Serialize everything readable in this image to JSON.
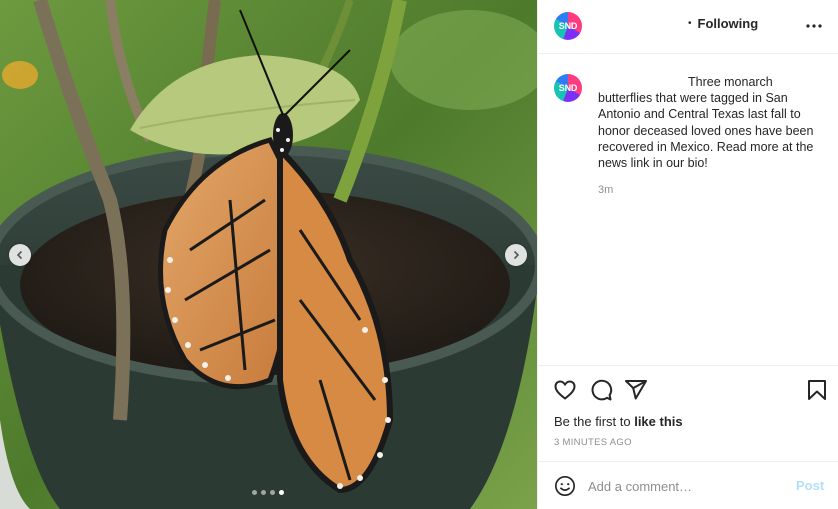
{
  "post": {
    "account_initials": "SND",
    "follow_status": "Following",
    "follow_separator": "•",
    "caption": "Three monarch butterflies that were tagged in San Antonio and Central Texas last fall to honor deceased loved ones have been recovered in Mexico. Read more at the news link in our bio!",
    "caption_age": "3m",
    "likes_prefix": "Be the first to ",
    "likes_cta": "like this",
    "time_ago": "3 MINUTES AGO"
  },
  "media": {
    "description_icon": "photo",
    "carousel_count": 4,
    "carousel_active_index": 3,
    "prev_icon": "chevron-left-icon",
    "next_icon": "chevron-right-icon"
  },
  "comment": {
    "placeholder": "Add a comment…",
    "post_label": "Post"
  },
  "icons": {
    "like": "heart-icon",
    "comment": "comment-bubble-icon",
    "share": "paper-plane-icon",
    "save": "bookmark-icon",
    "more": "ellipsis-icon",
    "emoji": "smiley-icon"
  },
  "colors": {
    "text": "#262626",
    "muted": "#8e8e8e",
    "divider": "#efefef",
    "post_disabled": "#b2dffc"
  }
}
